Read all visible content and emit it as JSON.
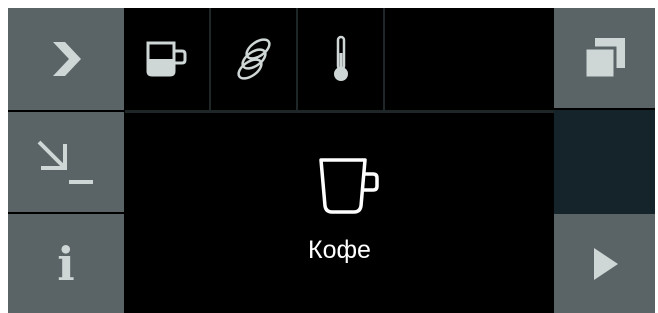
{
  "colors": {
    "panel_background": "#000000",
    "button_gray": "#5a6466",
    "button_dark": "#15242a",
    "icon_light": "#cfd6d6",
    "text": "#ffffff"
  },
  "left_buttons": [
    {
      "icon": "chevron-right-icon"
    },
    {
      "icon": "arrow-down-right-icon"
    },
    {
      "icon": "info-icon",
      "label": "i"
    }
  ],
  "right_buttons": [
    {
      "icon": "double-cup-icon"
    },
    {
      "icon": ""
    },
    {
      "icon": "play-icon"
    }
  ],
  "top_tiles": [
    {
      "icon": "cup-fill-level-icon"
    },
    {
      "icon": "coffee-beans-icon"
    },
    {
      "icon": "thermometer-icon"
    },
    {
      "icon": ""
    }
  ],
  "selected_drink": {
    "icon": "coffee-cup-icon",
    "label": "Кофе"
  }
}
